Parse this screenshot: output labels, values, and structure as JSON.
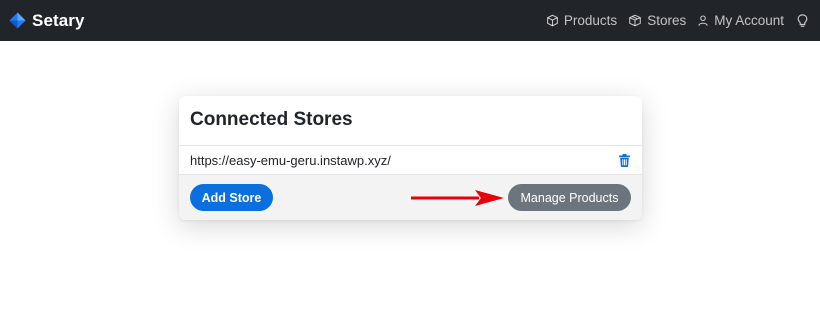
{
  "navbar": {
    "brand": "Setary",
    "links": [
      {
        "label": "Products",
        "icon": "box-icon"
      },
      {
        "label": "Stores",
        "icon": "boxes-icon"
      },
      {
        "label": "My Account",
        "icon": "user-icon"
      }
    ],
    "extra_icon": "lightbulb-icon"
  },
  "card": {
    "title": "Connected Stores",
    "stores": [
      {
        "url": "https://easy-emu-geru.instawp.xyz/"
      }
    ],
    "add_button": "Add Store",
    "manage_button": "Manage Products"
  },
  "colors": {
    "navbar_bg": "#212529",
    "primary": "#0b6fde",
    "secondary": "#6c757d",
    "arrow": "#e8000b",
    "footer_bg": "#f3f3f4"
  }
}
